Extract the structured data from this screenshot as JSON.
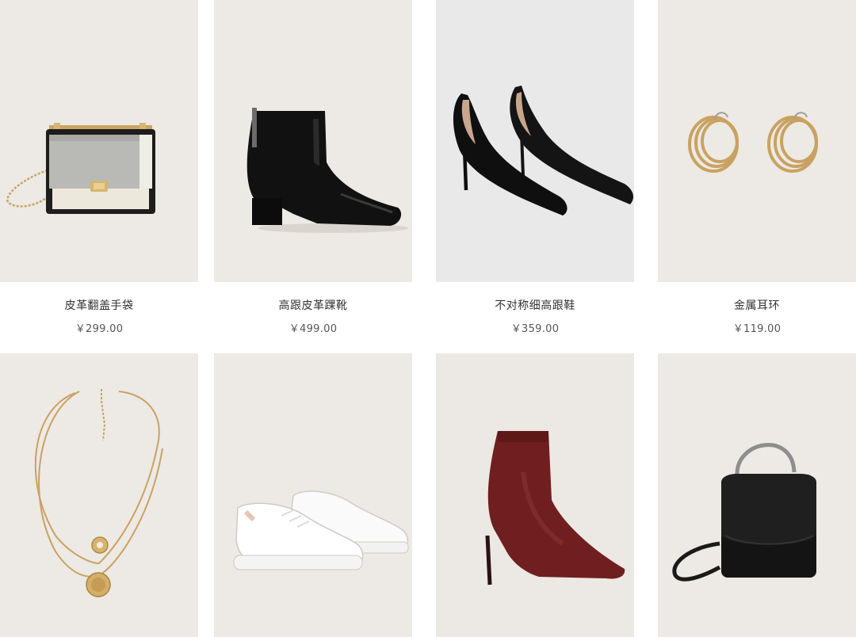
{
  "currency": "¥",
  "products": [
    {
      "name": "皮革翻盖手袋",
      "price": "￥299.00",
      "image": "gray-black-flap-crossbody-bag-with-gold-chain",
      "bg": "#ede9e4"
    },
    {
      "name": "高跟皮革踝靴",
      "price": "￥499.00",
      "image": "black-leather-block-heel-ankle-boot",
      "bg": "#ede9e4"
    },
    {
      "name": "不对称细高跟鞋",
      "price": "￥359.00",
      "image": "black-suede-asymmetric-stiletto-pumps",
      "bg": "#e9e9e9"
    },
    {
      "name": "金属耳环",
      "price": "￥119.00",
      "image": "gold-triple-hoop-earrings",
      "bg": "#ede9e4"
    },
    {
      "image": "gold-layered-coin-pendant-necklace",
      "bg": "#ede9e4"
    },
    {
      "image": "white-leather-sneakers",
      "bg": "#ede9e4"
    },
    {
      "image": "burgundy-knit-sock-boot-stiletto",
      "bg": "#ece8e3"
    },
    {
      "image": "black-top-handle-crossbody-bag",
      "bg": "#ede9e4"
    }
  ]
}
